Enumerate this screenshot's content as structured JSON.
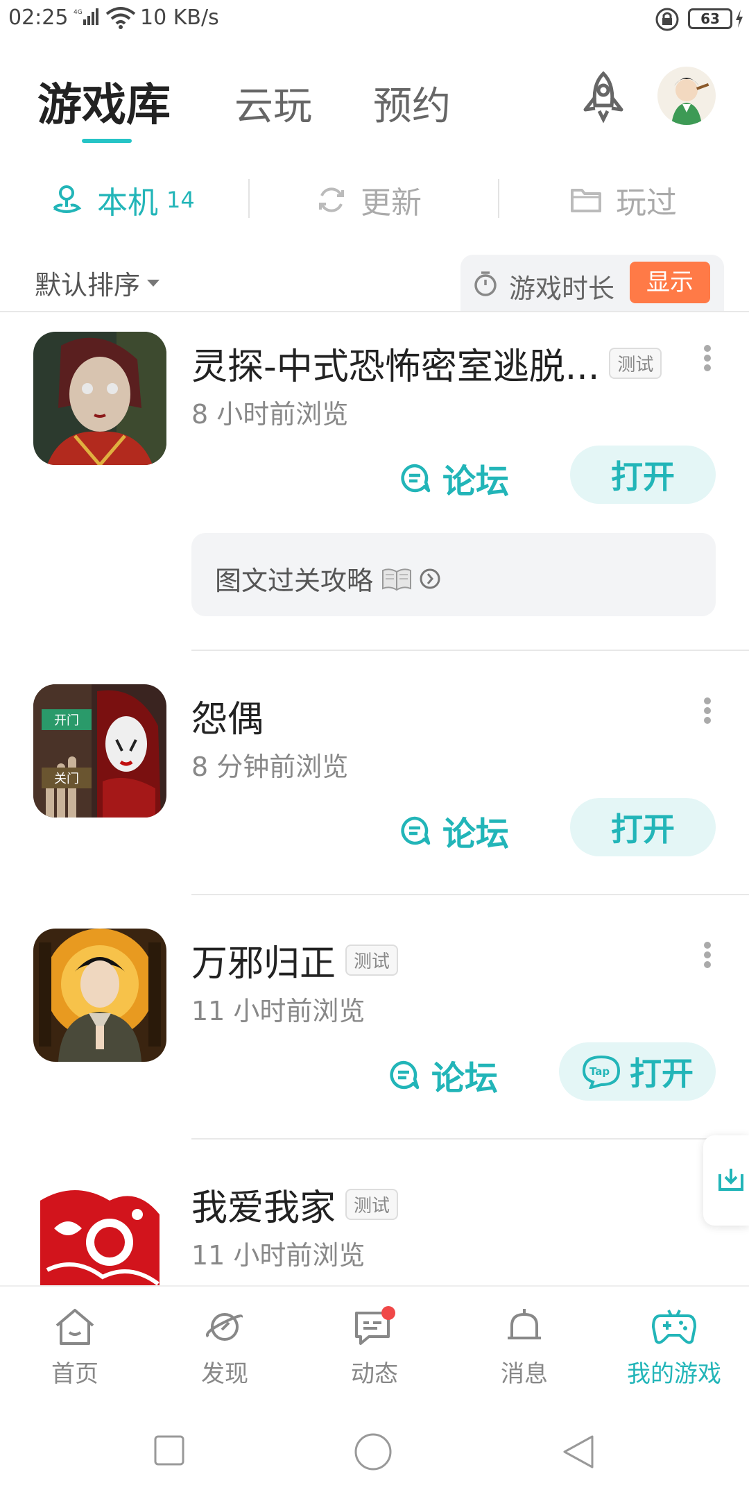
{
  "status": {
    "time": "02:25",
    "network": "4G",
    "speed": "10 KB/s",
    "battery": "63"
  },
  "header": {
    "tabs": [
      {
        "label": "游戏库",
        "active": true
      },
      {
        "label": "云玩",
        "active": false
      },
      {
        "label": "预约",
        "active": false
      }
    ]
  },
  "subtabs": {
    "local": {
      "label": "本机",
      "count": "14"
    },
    "update": {
      "label": "更新"
    },
    "played": {
      "label": "玩过"
    }
  },
  "sort": {
    "label": "默认排序"
  },
  "duration": {
    "label": "游戏时长",
    "button": "显示"
  },
  "games": [
    {
      "title": "灵探-中式恐怖密室逃脱...",
      "tag": "测试",
      "subtitle": "8 小时前浏览",
      "forum": "论坛",
      "open": "打开",
      "guide": "图文过关攻略"
    },
    {
      "title": "怨偶",
      "subtitle": "8 分钟前浏览",
      "forum": "论坛",
      "open": "打开",
      "icon_labels": [
        "开门",
        "关门"
      ]
    },
    {
      "title": "万邪归正",
      "tag": "测试",
      "subtitle": "11 小时前浏览",
      "forum": "论坛",
      "open": "打开",
      "open_badge": "Tap"
    },
    {
      "title": "我爱我家",
      "tag": "测试",
      "subtitle": "11 小时前浏览"
    }
  ],
  "bottom_nav": [
    {
      "label": "首页",
      "icon": "home-icon"
    },
    {
      "label": "发现",
      "icon": "planet-icon"
    },
    {
      "label": "动态",
      "icon": "chat-icon"
    },
    {
      "label": "消息",
      "icon": "bell-icon"
    },
    {
      "label": "我的游戏",
      "icon": "gamepad-icon",
      "active": true
    }
  ],
  "colors": {
    "accent": "#22b5b8",
    "show_button": "#ff7a47",
    "badge": "#f04848"
  }
}
